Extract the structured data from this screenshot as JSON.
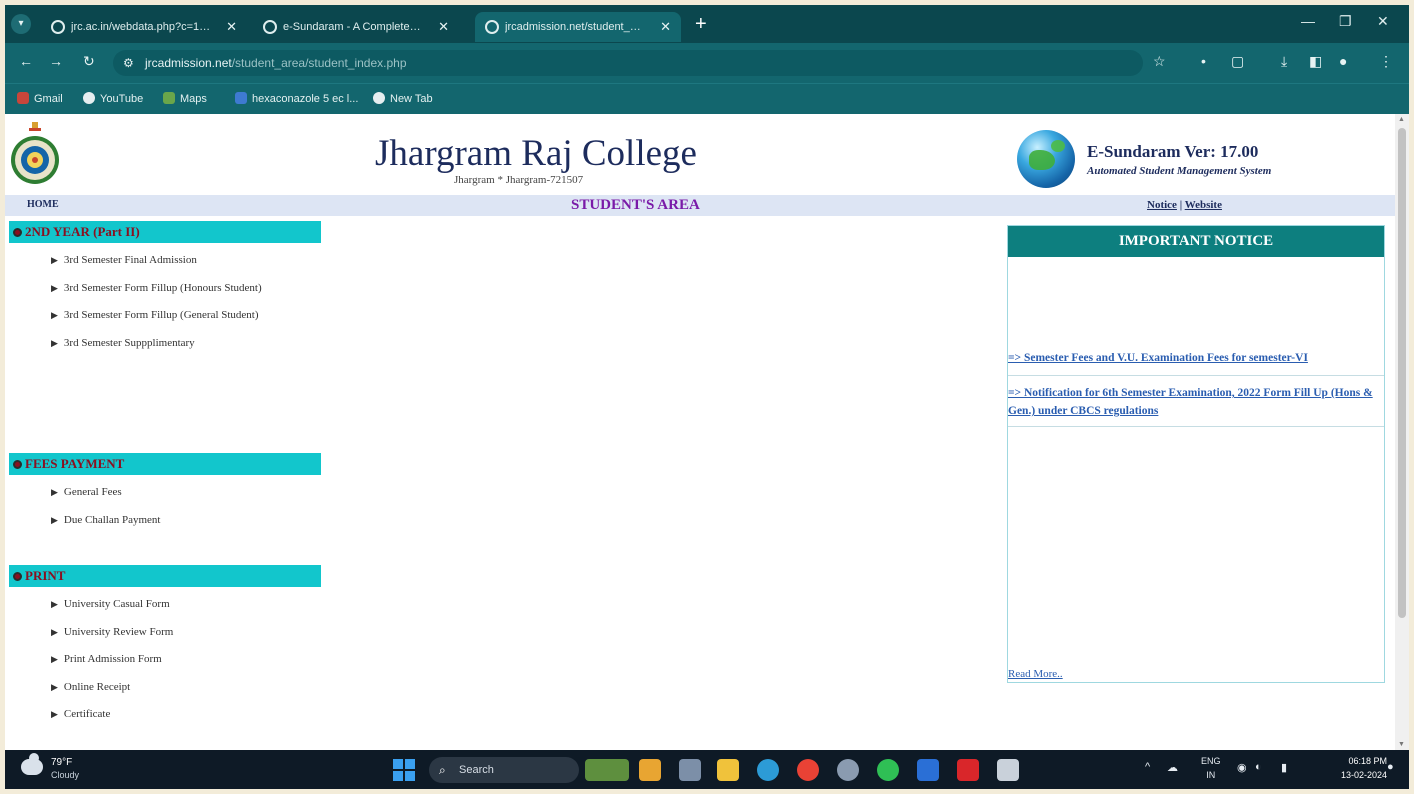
{
  "browser": {
    "tabs": [
      {
        "title": "jrc.ac.in/webdata.php?c=1476:",
        "active": false
      },
      {
        "title": "e-Sundaram - A Complete Onl",
        "active": false
      },
      {
        "title": "jrcadmission.net/student_area",
        "active": true
      }
    ],
    "new_tab": "+",
    "address": {
      "domain": "jrcadmission.net",
      "path": "/student_area/student_index.php"
    },
    "bookmarks": [
      "Gmail",
      "YouTube",
      "Maps",
      "hexaconazole 5 ec l...",
      "New Tab"
    ]
  },
  "header": {
    "college_name": "Jhargram Raj College",
    "college_address": "Jhargram * Jhargram-721507",
    "product_title": "E-Sundaram Ver: 17.00",
    "product_subtitle": "Automated Student Management System"
  },
  "menubar": {
    "home": "HOME",
    "area_title": "STUDENT'S AREA",
    "notice_link": "Notice",
    "separator": "|",
    "website_link": "Website"
  },
  "sidebar": {
    "sections": [
      {
        "title": "2ND YEAR (Part II)",
        "items": [
          "3rd Semester Final Admission",
          "3rd Semester Form Fillup (Honours Student)",
          "3rd Semester Form Fillup (General Student)",
          "3rd Semester Suppplimentary"
        ]
      },
      {
        "title": "FEES PAYMENT",
        "items": [
          "General Fees",
          "Due Challan Payment"
        ]
      },
      {
        "title": "PRINT",
        "items": [
          "University Casual Form",
          "University Review Form",
          "Print Admission Form",
          "Online Receipt",
          "Certificate"
        ]
      }
    ]
  },
  "notice": {
    "title": "IMPORTANT NOTICE",
    "items": [
      "=> Semester Fees and V.U. Examination Fees for semester-VI",
      "=> Notification for 6th Semester Examination, 2022 Form Fill Up (Hons & Gen.) under CBCS regulations"
    ],
    "read_more": "Read More.."
  },
  "taskbar": {
    "temperature": "79°F",
    "condition": "Cloudy",
    "search_placeholder": "Search",
    "language": "ENG",
    "region": "IN",
    "time": "06:18 PM",
    "date": "13-02-2024"
  },
  "colors": {
    "browser_chrome": "#13666e",
    "section_header": "#12c6cc",
    "notice_header": "#0d7f7f",
    "accent_purple": "#7a1aa8"
  }
}
